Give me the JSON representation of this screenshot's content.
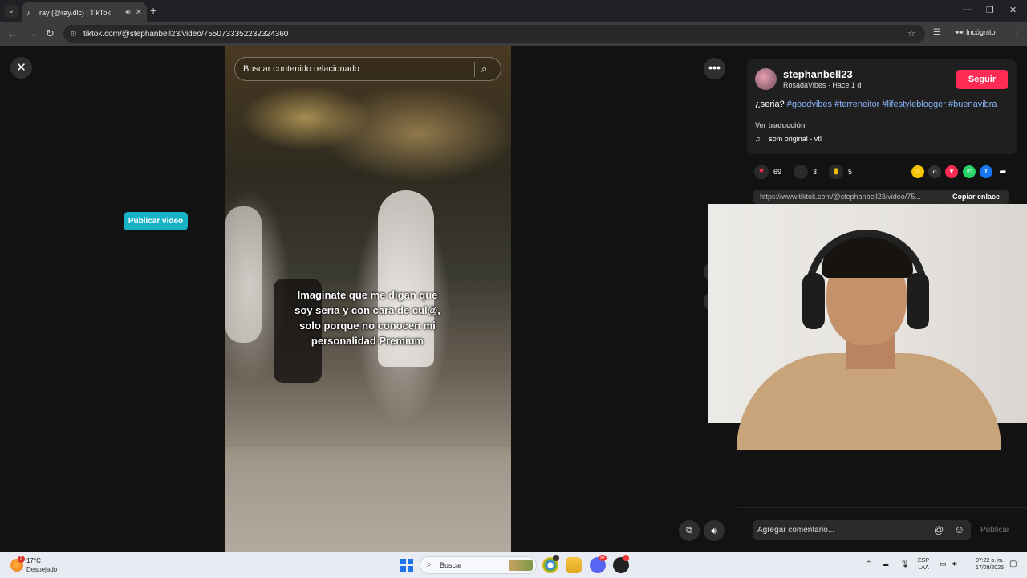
{
  "browser": {
    "tab_title": "ray (@ray.dlc) | TikTok",
    "url": "tiktok.com/@stephanbell23/video/7550733352232324360",
    "incognito_label": "Incógnito",
    "icons": {
      "new_tab": "plus-icon",
      "back": "arrow-left-icon",
      "forward": "arrow-right-icon",
      "reload": "reload-icon",
      "star": "star-icon"
    }
  },
  "page": {
    "publish_button": "Publicar video",
    "video_search_placeholder": "Buscar contenido relacionado",
    "video_overlay_text": "Imaginate que me digan que\nsoy seria y con cara de cul@,\nsolo porque no conocen mi\npersonalidad Premium"
  },
  "post": {
    "username": "stephanbell23",
    "subline": "RosadaVibes · Hace 1 d",
    "follow_label": "Seguir",
    "description_prefix": "¿seria?",
    "hashtags": [
      "#goodvibes",
      "#terreneitor",
      "#lifestyleblogger",
      "#buenavibra"
    ],
    "translate_label": "Ver traducción",
    "music": "som original - vt!",
    "likes": "69",
    "comments": "3",
    "saves": "5",
    "share_url": "https://www.tiktok.com/@stephanbell23/video/75...",
    "copy_link_label": "Copiar enlace",
    "comment_placeholder": "Agregar comentario...",
    "post_comment_label": "Publicar",
    "accent_color": "#fe2c55"
  },
  "taskbar": {
    "weather_badge": "2",
    "temperature": "17°C",
    "weather": "Despejado",
    "search_label": "Buscar",
    "discord_badge": "9+",
    "lang_1": "ESP",
    "lang_2": "LAA",
    "time": "07:22 p. m.",
    "date": "17/09/2025"
  }
}
